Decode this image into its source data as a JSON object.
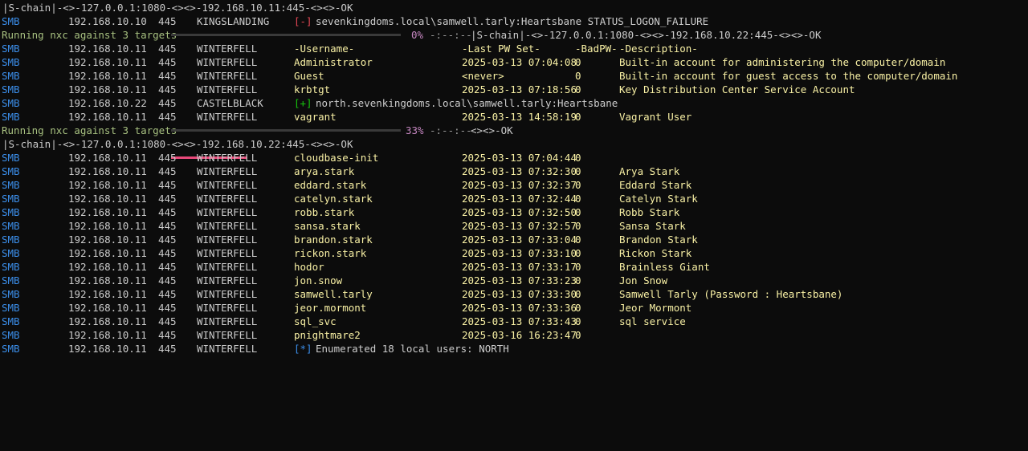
{
  "progress_bars": [
    {
      "label": "Running nxc against 3 targets",
      "percent_text": "0%",
      "tail": "-:--:--",
      "percent": 0
    },
    {
      "label": "Running nxc against 3 targets",
      "percent_text": "33%",
      "tail": "-:--:--",
      "percent": 33
    }
  ],
  "proxy_lines": {
    "first": "|S-chain|-<>-127.0.0.1:1080-<><>-192.168.10.11:445-<><>-OK",
    "second_inline": "|S-chain|-<>-127.0.0.1:1080-<><>-192.168.10.22:445-<><>-OK",
    "third_tail": "<><>-OK",
    "fourth": "|S-chain|-<>-127.0.0.1:1080-<><>-192.168.10.22:445-<><>-OK"
  },
  "login_fail": {
    "proto": "SMB",
    "ip": "192.168.10.10",
    "port": "445",
    "host": "KINGSLANDING",
    "tag": "[-]",
    "msg": "sevenkingdoms.local\\samwell.tarly:Heartsbane STATUS_LOGON_FAILURE"
  },
  "header_row": {
    "proto": "SMB",
    "ip": "192.168.10.11",
    "port": "445",
    "host": "WINTERFELL",
    "username": "-Username-",
    "lastpw": "-Last PW Set-",
    "badpw": "-BadPW-",
    "desc": "-Description-"
  },
  "users_a": [
    {
      "proto": "SMB",
      "ip": "192.168.10.11",
      "port": "445",
      "host": "WINTERFELL",
      "username": "Administrator",
      "lastpw": "2025-03-13 07:04:08",
      "badpw": "0",
      "desc": "Built-in account for administering the computer/domain"
    },
    {
      "proto": "SMB",
      "ip": "192.168.10.11",
      "port": "445",
      "host": "WINTERFELL",
      "username": "Guest",
      "lastpw": "<never>",
      "badpw": "0",
      "desc": "Built-in account for guest access to the computer/domain"
    },
    {
      "proto": "SMB",
      "ip": "192.168.10.11",
      "port": "445",
      "host": "WINTERFELL",
      "username": "krbtgt",
      "lastpw": "2025-03-13 07:18:56",
      "badpw": "0",
      "desc": "Key Distribution Center Service Account"
    }
  ],
  "login_ok": {
    "proto": "SMB",
    "ip": "192.168.10.22",
    "port": "445",
    "host": "CASTELBLACK",
    "tag": "[+]",
    "msg": "north.sevenkingdoms.local\\samwell.tarly:Heartsbane"
  },
  "users_b": [
    {
      "proto": "SMB",
      "ip": "192.168.10.11",
      "port": "445",
      "host": "WINTERFELL",
      "username": "vagrant",
      "lastpw": "2025-03-13 14:58:19",
      "badpw": "0",
      "desc": "Vagrant User"
    }
  ],
  "users_c": [
    {
      "proto": "SMB",
      "ip": "192.168.10.11",
      "port": "445",
      "host": "WINTERFELL",
      "username": "cloudbase-init",
      "lastpw": "2025-03-13 07:04:44",
      "badpw": "0",
      "desc": ""
    },
    {
      "proto": "SMB",
      "ip": "192.168.10.11",
      "port": "445",
      "host": "WINTERFELL",
      "username": "arya.stark",
      "lastpw": "2025-03-13 07:32:30",
      "badpw": "0",
      "desc": "Arya Stark"
    },
    {
      "proto": "SMB",
      "ip": "192.168.10.11",
      "port": "445",
      "host": "WINTERFELL",
      "username": "eddard.stark",
      "lastpw": "2025-03-13 07:32:37",
      "badpw": "0",
      "desc": "Eddard Stark"
    },
    {
      "proto": "SMB",
      "ip": "192.168.10.11",
      "port": "445",
      "host": "WINTERFELL",
      "username": "catelyn.stark",
      "lastpw": "2025-03-13 07:32:44",
      "badpw": "0",
      "desc": "Catelyn Stark"
    },
    {
      "proto": "SMB",
      "ip": "192.168.10.11",
      "port": "445",
      "host": "WINTERFELL",
      "username": "robb.stark",
      "lastpw": "2025-03-13 07:32:50",
      "badpw": "0",
      "desc": "Robb Stark"
    },
    {
      "proto": "SMB",
      "ip": "192.168.10.11",
      "port": "445",
      "host": "WINTERFELL",
      "username": "sansa.stark",
      "lastpw": "2025-03-13 07:32:57",
      "badpw": "0",
      "desc": "Sansa Stark"
    },
    {
      "proto": "SMB",
      "ip": "192.168.10.11",
      "port": "445",
      "host": "WINTERFELL",
      "username": "brandon.stark",
      "lastpw": "2025-03-13 07:33:04",
      "badpw": "0",
      "desc": "Brandon Stark"
    },
    {
      "proto": "SMB",
      "ip": "192.168.10.11",
      "port": "445",
      "host": "WINTERFELL",
      "username": "rickon.stark",
      "lastpw": "2025-03-13 07:33:10",
      "badpw": "0",
      "desc": "Rickon Stark"
    },
    {
      "proto": "SMB",
      "ip": "192.168.10.11",
      "port": "445",
      "host": "WINTERFELL",
      "username": "hodor",
      "lastpw": "2025-03-13 07:33:17",
      "badpw": "0",
      "desc": "Brainless Giant"
    },
    {
      "proto": "SMB",
      "ip": "192.168.10.11",
      "port": "445",
      "host": "WINTERFELL",
      "username": "jon.snow",
      "lastpw": "2025-03-13 07:33:23",
      "badpw": "0",
      "desc": "Jon Snow"
    },
    {
      "proto": "SMB",
      "ip": "192.168.10.11",
      "port": "445",
      "host": "WINTERFELL",
      "username": "samwell.tarly",
      "lastpw": "2025-03-13 07:33:30",
      "badpw": "0",
      "desc": "Samwell Tarly (Password : Heartsbane)"
    },
    {
      "proto": "SMB",
      "ip": "192.168.10.11",
      "port": "445",
      "host": "WINTERFELL",
      "username": "jeor.mormont",
      "lastpw": "2025-03-13 07:33:36",
      "badpw": "0",
      "desc": "Jeor Mormont"
    },
    {
      "proto": "SMB",
      "ip": "192.168.10.11",
      "port": "445",
      "host": "WINTERFELL",
      "username": "sql_svc",
      "lastpw": "2025-03-13 07:33:43",
      "badpw": "0",
      "desc": "sql service"
    },
    {
      "proto": "SMB",
      "ip": "192.168.10.11",
      "port": "445",
      "host": "WINTERFELL",
      "username": "pnightmare2",
      "lastpw": "2025-03-16 16:23:47",
      "badpw": "0",
      "desc": ""
    }
  ],
  "summary": {
    "proto": "SMB",
    "ip": "192.168.10.11",
    "port": "445",
    "host": "WINTERFELL",
    "tag": "[*]",
    "msg": "Enumerated 18 local users: NORTH"
  },
  "colors": {
    "background": "#0c0c0c",
    "text": "#cccccc",
    "proto_blue": "#3b8eea",
    "fail_red": "#e74856",
    "ok_green": "#16c60c",
    "user_gold": "#f9f1a5",
    "progress_green": "#a7c080",
    "progress_pink": "#e8497a"
  }
}
